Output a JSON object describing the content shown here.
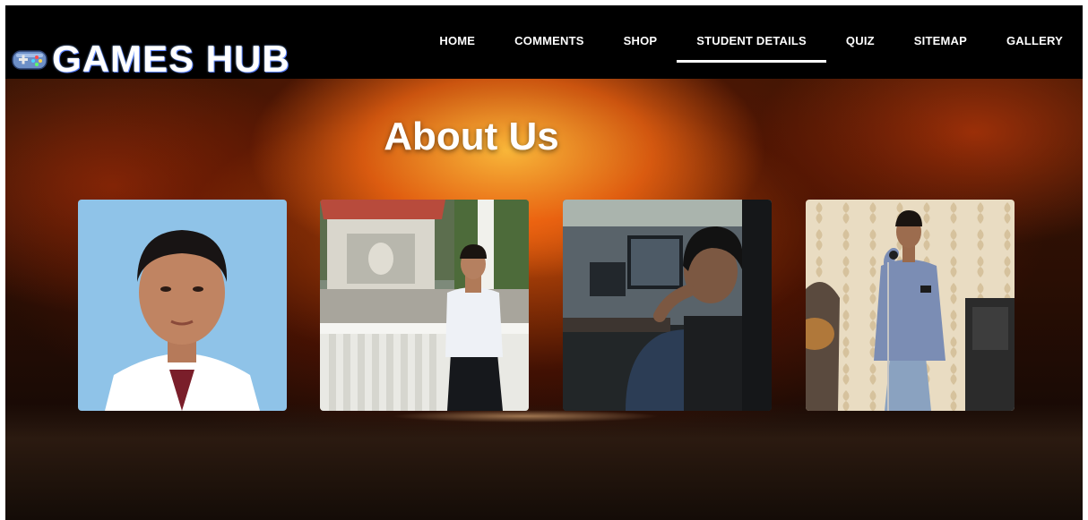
{
  "brand": {
    "title": "GAMES HUB",
    "icon": "gamepad-icon"
  },
  "nav": {
    "items": [
      {
        "label": "HOME",
        "active": false
      },
      {
        "label": "COMMENTS",
        "active": false
      },
      {
        "label": "SHOP",
        "active": false
      },
      {
        "label": "STUDENT DETAILS",
        "active": true
      },
      {
        "label": "QUIZ",
        "active": false
      },
      {
        "label": "SITEMAP",
        "active": false
      },
      {
        "label": "GALLERY",
        "active": false
      }
    ]
  },
  "hero": {
    "title": "About Us",
    "members": [
      {
        "photo": "member-photo-1"
      },
      {
        "photo": "member-photo-2"
      },
      {
        "photo": "member-photo-3"
      },
      {
        "photo": "member-photo-4"
      }
    ]
  },
  "colors": {
    "nav_bg": "#000000",
    "text": "#ffffff",
    "fire": "#e8661a"
  }
}
